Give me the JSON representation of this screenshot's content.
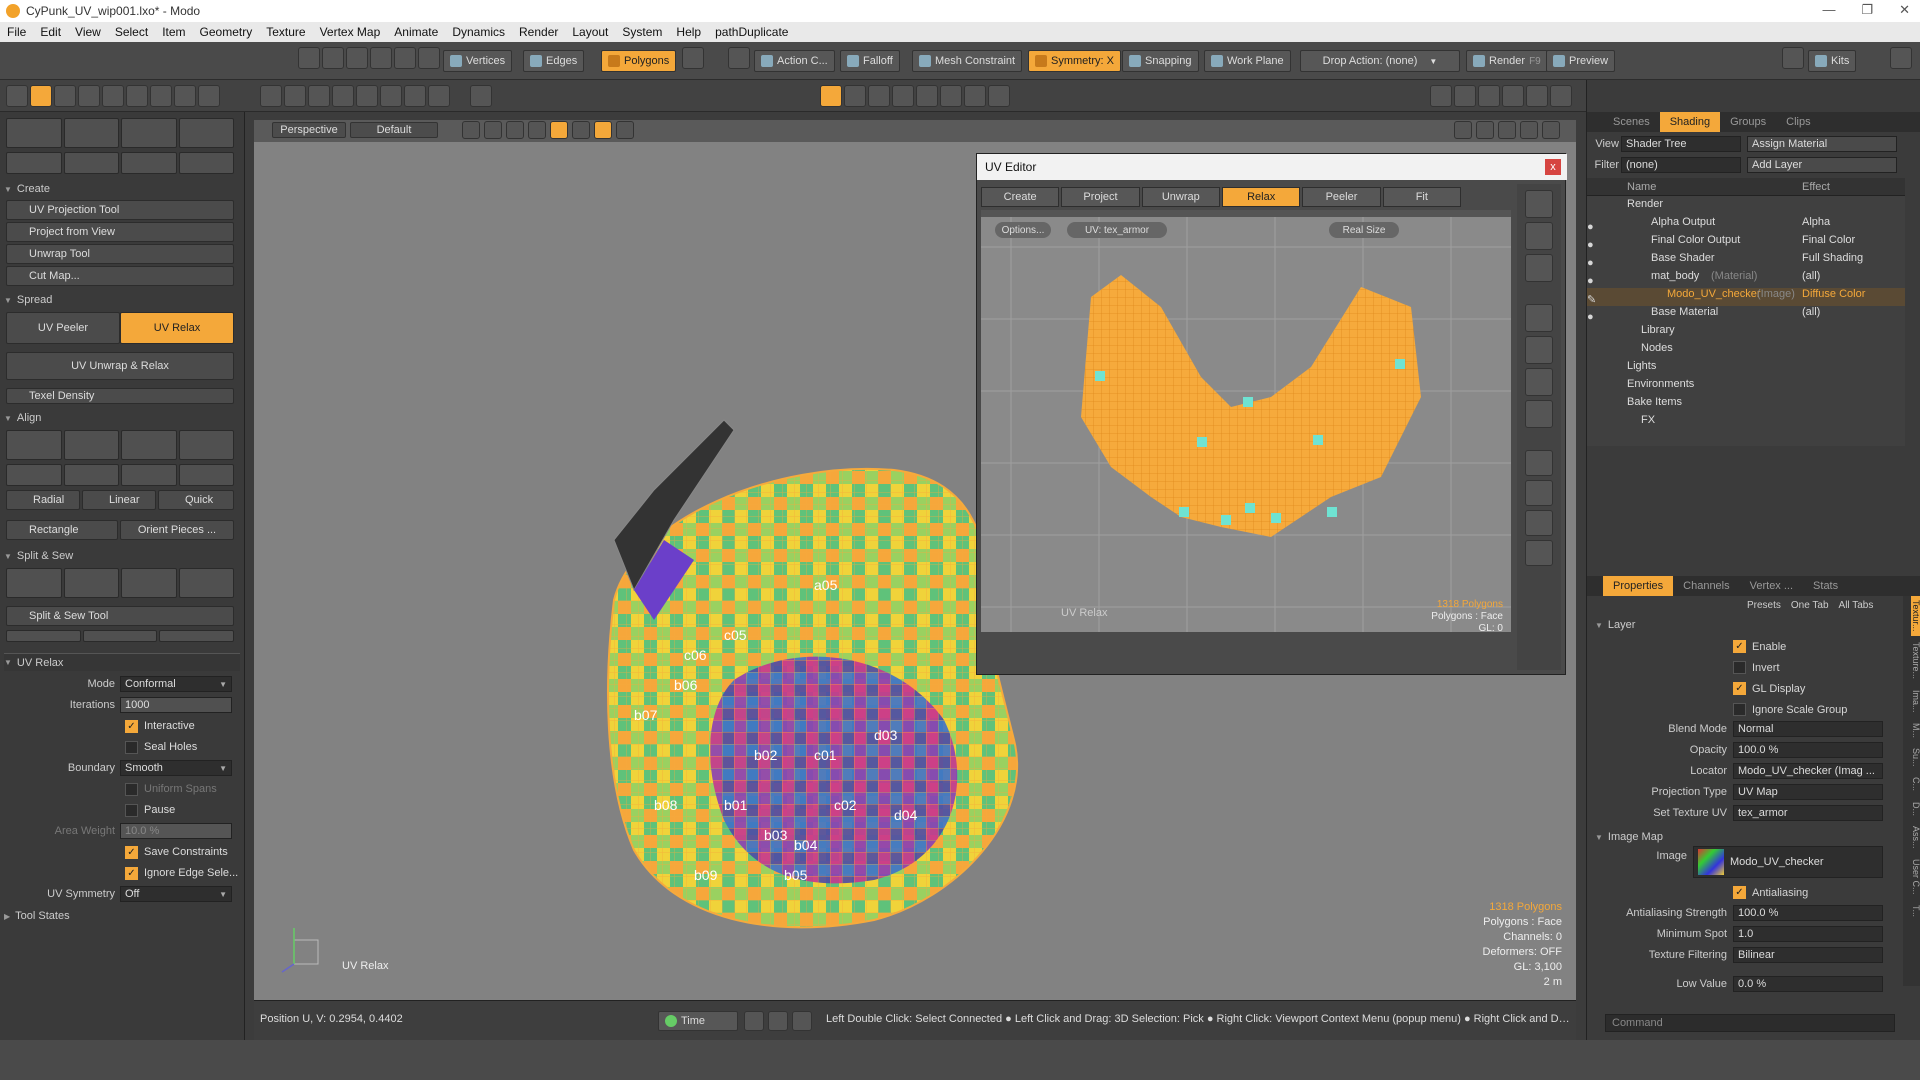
{
  "window": {
    "title": "CyPunk_UV_wip001.lxo* - Modo",
    "min": "—",
    "max": "❐",
    "close": "✕"
  },
  "menu": [
    "File",
    "Edit",
    "View",
    "Select",
    "Item",
    "Geometry",
    "Texture",
    "Vertex Map",
    "Animate",
    "Dynamics",
    "Render",
    "Layout",
    "System",
    "Help",
    "pathDuplicate"
  ],
  "toolbar": {
    "vertices": "Vertices",
    "edges": "Edges",
    "polygons": "Polygons",
    "action_center": "Action C...",
    "falloff": "Falloff",
    "mesh_constraint": "Mesh Constraint",
    "symmetry": "Symmetry: X",
    "snapping": "Snapping",
    "work_plane": "Work Plane",
    "drop_action": "Drop Action: (none)",
    "render": "Render",
    "render_key": "F9",
    "preview": "Preview",
    "kits": "Kits"
  },
  "left": {
    "create_header": "Create",
    "create_items": [
      "UV Projection Tool",
      "Project from View",
      "Unwrap Tool",
      "Cut Map..."
    ],
    "spread_header": "Spread",
    "uv_peeler": "UV Peeler",
    "uv_relax": "UV Relax",
    "uv_unwrap_relax": "UV Unwrap & Relax",
    "texel_density": "Texel Density",
    "align_header": "Align",
    "radial": "Radial",
    "linear": "Linear",
    "quick": "Quick",
    "rectangle": "Rectangle",
    "orient_pieces": "Orient Pieces ...",
    "split_sew_header": "Split & Sew",
    "split_sew_tool": "Split & Sew Tool",
    "uvrelax_header": "UV Relax",
    "mode_label": "Mode",
    "mode_value": "Conformal",
    "iterations_label": "Iterations",
    "iterations_value": "1000",
    "interactive": "Interactive",
    "seal_holes": "Seal Holes",
    "boundary_label": "Boundary",
    "boundary_value": "Smooth",
    "uniform_spans": "Uniform Spans",
    "pause": "Pause",
    "area_weight_label": "Area Weight",
    "area_weight_value": "10.0 %",
    "save_constraints": "Save Constraints",
    "ignore_edge_sel": "Ignore Edge Sele...",
    "uv_symmetry_label": "UV Symmetry",
    "uv_symmetry_value": "Off",
    "tool_states": "Tool States"
  },
  "viewport": {
    "perspective": "Perspective",
    "default": "Default",
    "tool_label": "UV Relax",
    "stats": [
      "1318 Polygons",
      "Polygons : Face",
      "Channels: 0",
      "Deformers: OFF",
      "GL: 3,100",
      "2 m"
    ],
    "checker_labels": [
      "b01",
      "b02",
      "b03",
      "b04",
      "b05",
      "b06",
      "c01",
      "c02",
      "c05",
      "c06",
      "a05",
      "b07",
      "b08",
      "b09",
      "d03",
      "d04"
    ]
  },
  "uv_editor": {
    "title": "UV Editor",
    "close": "x",
    "tabs": [
      "Create",
      "Project",
      "Unwrap",
      "Relax",
      "Peeler",
      "Fit"
    ],
    "options": "Options...",
    "uv_map": "UV: tex_armor",
    "real_size": "Real Size",
    "tool_label": "UV Relax",
    "stats": [
      "1318 Polygons",
      "Polygons : Face",
      "GL: 0"
    ]
  },
  "right": {
    "top_tabs": [
      "Scenes",
      "Shading",
      "Groups",
      "Clips"
    ],
    "view_label": "View",
    "view_value": "Shader Tree",
    "assign_material": "Assign Material",
    "filter_label": "Filter",
    "filter_value": "(none)",
    "add_layer": "Add Layer",
    "col_name": "Name",
    "col_effect": "Effect",
    "tree": [
      {
        "name": "Render",
        "effect": ""
      },
      {
        "name": "Alpha Output",
        "effect": "Alpha"
      },
      {
        "name": "Final Color Output",
        "effect": "Final Color"
      },
      {
        "name": "Base Shader",
        "effect": "Full Shading"
      },
      {
        "name": "mat_body",
        "note": "(Material)",
        "effect": "(all)"
      },
      {
        "name": "Modo_UV_checker",
        "note": "(Image)",
        "effect": "Diffuse Color"
      },
      {
        "name": "Base Material",
        "effect": "(all)"
      },
      {
        "name": "Library",
        "effect": ""
      },
      {
        "name": "Nodes",
        "effect": ""
      },
      {
        "name": "Lights",
        "effect": ""
      },
      {
        "name": "Environments",
        "effect": ""
      },
      {
        "name": "Bake Items",
        "effect": ""
      },
      {
        "name": "FX",
        "effect": ""
      }
    ],
    "prop_tabs": [
      "Properties",
      "Channels",
      "Vertex ...",
      "Stats"
    ],
    "presets": "Presets",
    "one_tab": "One Tab",
    "all_tabs": "All Tabs",
    "layer_header": "Layer",
    "enable": "Enable",
    "invert": "Invert",
    "gl_display": "GL Display",
    "ignore_scale_group": "Ignore Scale Group",
    "blend_mode_label": "Blend Mode",
    "blend_mode_value": "Normal",
    "opacity_label": "Opacity",
    "opacity_value": "100.0 %",
    "locator_label": "Locator",
    "locator_value": "Modo_UV_checker (Imag ...",
    "projection_label": "Projection Type",
    "projection_value": "UV Map",
    "set_texture_label": "Set Texture UV",
    "set_texture_value": "tex_armor",
    "image_map_header": "Image Map",
    "image_label": "Image",
    "image_value": "Modo_UV_checker",
    "antialiasing": "Antialiasing",
    "aa_strength_label": "Antialiasing Strength",
    "aa_strength_value": "100.0 %",
    "min_spot_label": "Minimum Spot",
    "min_spot_value": "1.0",
    "tex_filter_label": "Texture Filtering",
    "tex_filter_value": "Bilinear",
    "low_value_label": "Low Value",
    "low_value_value": "0.0 %",
    "side_tabs": [
      "Textur...",
      "Texture...",
      "Ima...",
      "M...",
      "Su...",
      "C...",
      "D...",
      "Ass...",
      "User C...",
      "T..."
    ],
    "command_placeholder": "Command"
  },
  "status": {
    "position": "Position U, V:   0.2954, 0.4402",
    "time": "Time",
    "hint": "Left Double Click: Select Connected ● Left Click and Drag: 3D Selection: Pick ● Right Click: Viewport Context Menu (popup menu) ● Right Click and Dra..."
  },
  "colors": {
    "accent": "#f4a83a",
    "uv_mesh": "#f6aa3c",
    "vertex_marker": "#6fe3d2"
  }
}
